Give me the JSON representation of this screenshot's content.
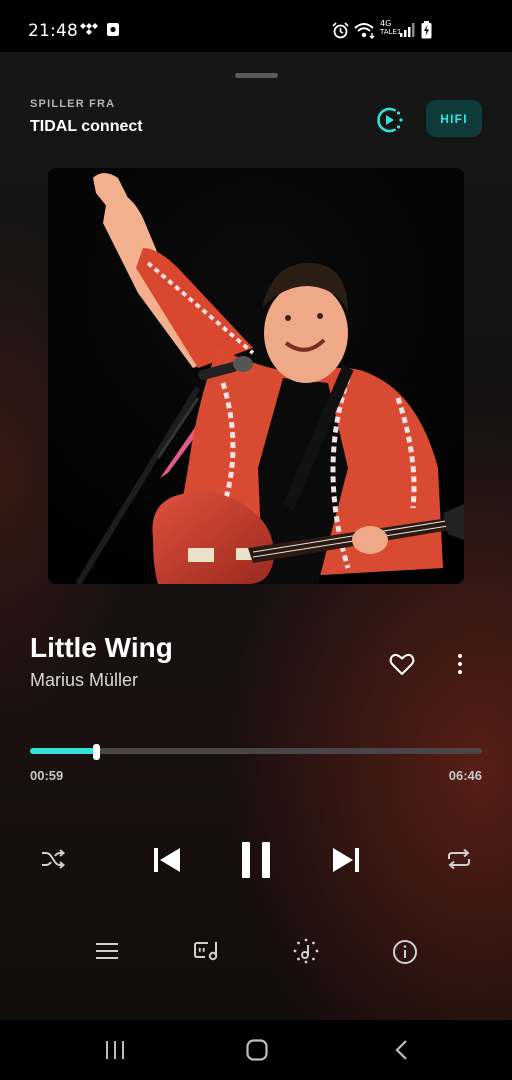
{
  "status_bar": {
    "time": "21:48",
    "network_label": "4G",
    "carrier_label": "TALE1",
    "icons": [
      "tidal-icon",
      "recorder-icon",
      "alarm-icon",
      "wifi-icon",
      "signal-icon",
      "battery-charging-icon"
    ]
  },
  "header": {
    "playing_from_label": "SPILLER FRA",
    "source_name": "TIDAL connect",
    "connect_icon": "tidal-connect-icon",
    "quality_badge": "HIFI"
  },
  "track": {
    "title": "Little Wing",
    "artist": "Marius Müller",
    "artwork_icon": "album-artwork"
  },
  "progress": {
    "current": "00:59",
    "total": "06:46",
    "fraction": 0.145
  },
  "controls": [
    "shuffle-icon",
    "previous-icon",
    "pause-icon",
    "next-icon",
    "repeat-icon"
  ],
  "bottom_actions": [
    "queue-icon",
    "lyrics-icon",
    "credits-icon",
    "info-icon"
  ],
  "nav_bar": [
    "recents-icon",
    "home-icon",
    "back-icon"
  ],
  "colors": {
    "accent": "#35e0d8",
    "hifi_badge_bg": "#0f3b3a",
    "hifi_badge_text": "#33e6df",
    "progress_track": "#4b4545"
  }
}
